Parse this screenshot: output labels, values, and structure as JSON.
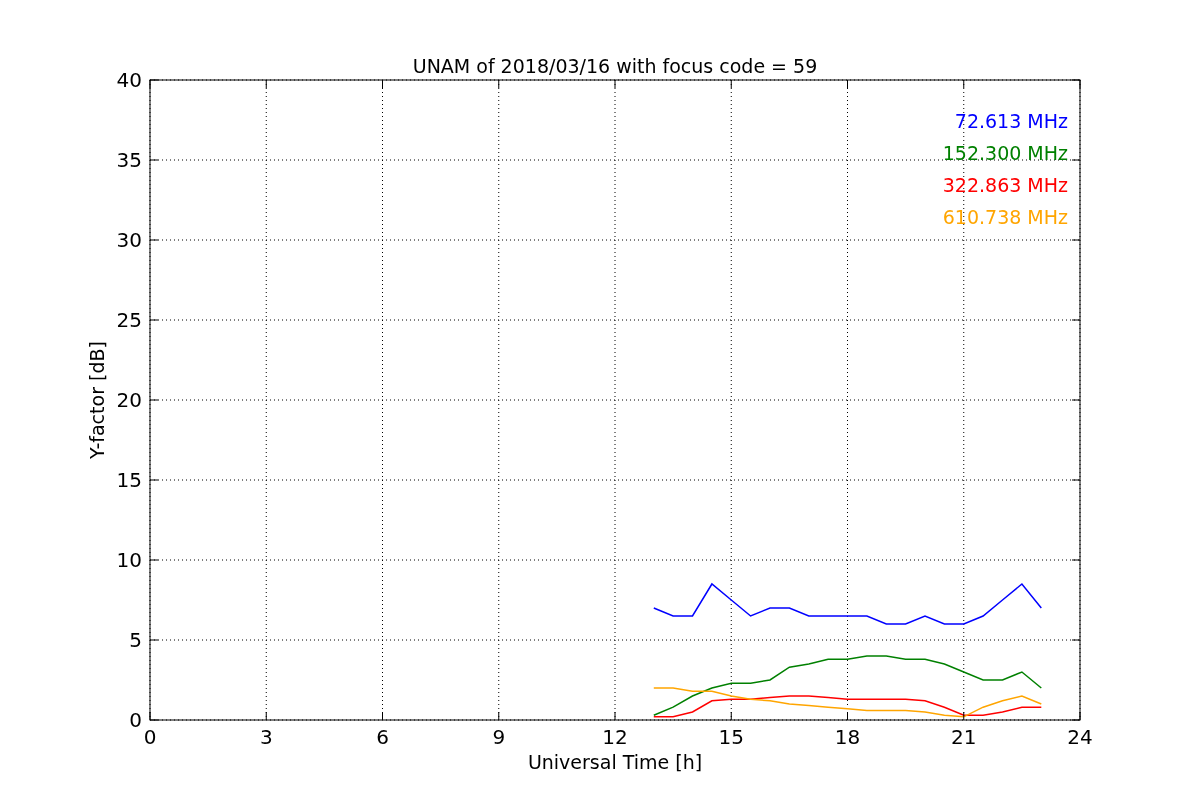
{
  "chart": {
    "chart_data": {
      "type": "line",
      "title": "UNAM of 2018/03/16 with focus code = 59",
      "xlabel": "Universal Time [h]",
      "ylabel": "Y-factor [dB]",
      "x": [
        13,
        13.5,
        14,
        14.5,
        15,
        15.5,
        16,
        16.5,
        17,
        17.5,
        18,
        18.5,
        19,
        19.5,
        20,
        20.5,
        21,
        21.5,
        22,
        22.5,
        23
      ],
      "series": [
        {
          "name": "72.613 MHz",
          "color": "#0000ff",
          "values": [
            7,
            6.5,
            6.5,
            8.5,
            7.5,
            6.5,
            7,
            7,
            6.5,
            6.5,
            6.5,
            6.5,
            6,
            6,
            6.5,
            6,
            6,
            6.5,
            7.5,
            8.5,
            7
          ]
        },
        {
          "name": "152.300 MHz",
          "color": "#008000",
          "values": [
            0.3,
            0.8,
            1.5,
            2,
            2.3,
            2.3,
            2.5,
            3.3,
            3.5,
            3.8,
            3.8,
            4,
            4,
            3.8,
            3.8,
            3.5,
            3,
            2.5,
            2.5,
            3,
            2
          ]
        },
        {
          "name": "322.863 MHz",
          "color": "#ff0000",
          "values": [
            0.2,
            0.2,
            0.5,
            1.2,
            1.3,
            1.3,
            1.4,
            1.5,
            1.5,
            1.4,
            1.3,
            1.3,
            1.3,
            1.3,
            1.2,
            0.8,
            0.3,
            0.3,
            0.5,
            0.8,
            0.8
          ]
        },
        {
          "name": "610.738 MHz",
          "color": "#ffa500",
          "values": [
            2,
            2,
            1.8,
            1.8,
            1.5,
            1.3,
            1.2,
            1,
            0.9,
            0.8,
            0.7,
            0.6,
            0.6,
            0.6,
            0.5,
            0.3,
            0.2,
            0.8,
            1.2,
            1.5,
            1
          ]
        }
      ],
      "grid": true,
      "xlim": [
        0,
        24
      ],
      "ylim": [
        0,
        40
      ],
      "xticks": [
        0,
        3,
        6,
        9,
        12,
        15,
        18,
        21,
        24
      ],
      "yticks": [
        0,
        5,
        10,
        15,
        20,
        25,
        30,
        35,
        40
      ]
    }
  }
}
